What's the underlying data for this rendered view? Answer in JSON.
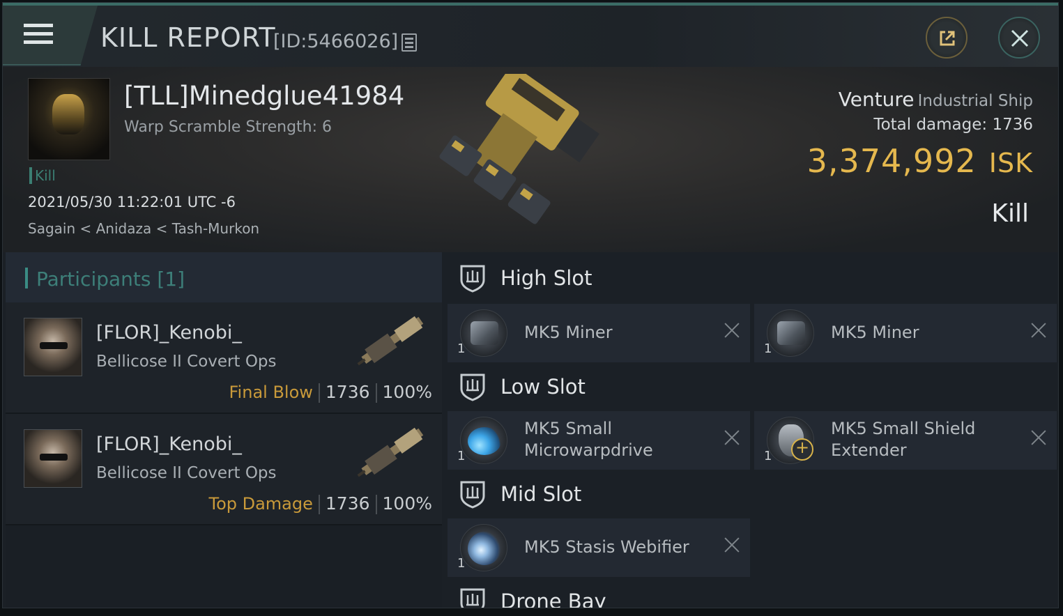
{
  "header": {
    "title": "KILL REPORT",
    "report_id": "[ID:5466026]"
  },
  "victim": {
    "name": "[TLL]Minedglue41984",
    "warp_scramble": "Warp Scramble Strength: 6",
    "tag": "Kill",
    "datetime": "2021/05/30 11:22:01 UTC -6",
    "location": "Sagain < Anidaza < Tash-Murkon",
    "ship_name": "Venture",
    "ship_class": "Industrial Ship",
    "total_damage_label": "Total damage:",
    "total_damage": "1736",
    "isk_value": "3,374,992",
    "isk_unit": "ISK",
    "result": "Kill"
  },
  "participants": {
    "header": "Participants [1]",
    "rows": [
      {
        "name": "[FLOR]_Kenobi_",
        "ship": "Bellicose II Covert Ops",
        "role": "Final Blow",
        "damage": "1736",
        "percent": "100%"
      },
      {
        "name": "[FLOR]_Kenobi_",
        "ship": "Bellicose II Covert Ops",
        "role": "Top Damage",
        "damage": "1736",
        "percent": "100%"
      }
    ]
  },
  "slots": {
    "high": {
      "label": "High Slot",
      "items": [
        {
          "qty": "1",
          "name": "MK5 Miner",
          "icon": "miner-icon"
        },
        {
          "qty": "1",
          "name": "MK5 Miner",
          "icon": "miner-icon"
        }
      ]
    },
    "low": {
      "label": "Low Slot",
      "items": [
        {
          "qty": "1",
          "name_line1": "MK5 Small",
          "name_line2": "Microwarpdrive",
          "icon": "microwarpdrive-icon"
        },
        {
          "qty": "1",
          "name_line1": "MK5 Small Shield",
          "name_line2": "Extender",
          "icon": "shield-extender-icon"
        }
      ]
    },
    "mid": {
      "label": "Mid Slot",
      "items": [
        {
          "qty": "1",
          "name": "MK5 Stasis Webifier",
          "icon": "stasis-webifier-icon"
        }
      ]
    },
    "drone": {
      "label": "Drone Bay"
    }
  },
  "colors": {
    "accent_teal": "#3a8c84",
    "isk_gold": "#e5b84e",
    "role_gold": "#c99a3a"
  }
}
